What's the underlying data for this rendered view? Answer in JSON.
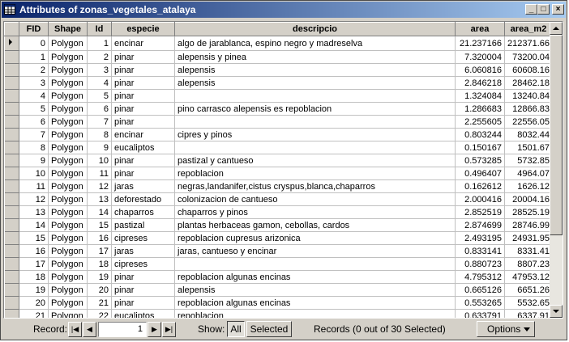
{
  "window": {
    "title": "Attributes of zonas_vegetales_atalaya"
  },
  "title_buttons": {
    "minimize": "_",
    "maximize": "□",
    "close": "×"
  },
  "table": {
    "columns": [
      "FID",
      "Shape",
      "Id",
      "especie",
      "descripcio",
      "area",
      "area_m2"
    ],
    "rows": [
      [
        "0",
        "Polygon",
        "1",
        "encinar",
        "algo de jarablanca, espino negro y madreselva",
        "21.237166",
        "212371.66"
      ],
      [
        "1",
        "Polygon",
        "2",
        "pinar",
        "alepensis y pinea",
        "7.320004",
        "73200.04"
      ],
      [
        "2",
        "Polygon",
        "3",
        "pinar",
        "alepensis",
        "6.060816",
        "60608.16"
      ],
      [
        "3",
        "Polygon",
        "4",
        "pinar",
        "alepensis",
        "2.846218",
        "28462.18"
      ],
      [
        "4",
        "Polygon",
        "5",
        "pinar",
        "",
        "1.324084",
        "13240.84"
      ],
      [
        "5",
        "Polygon",
        "6",
        "pinar",
        "pino carrasco alepensis es repoblacion",
        "1.286683",
        "12866.83"
      ],
      [
        "6",
        "Polygon",
        "7",
        "pinar",
        "",
        "2.255605",
        "22556.05"
      ],
      [
        "7",
        "Polygon",
        "8",
        "encinar",
        "cipres y pinos",
        "0.803244",
        "8032.44"
      ],
      [
        "8",
        "Polygon",
        "9",
        "eucaliptos",
        "",
        "0.150167",
        "1501.67"
      ],
      [
        "9",
        "Polygon",
        "10",
        "pinar",
        "pastizal y cantueso",
        "0.573285",
        "5732.85"
      ],
      [
        "10",
        "Polygon",
        "11",
        "pinar",
        "repoblacion",
        "0.496407",
        "4964.07"
      ],
      [
        "11",
        "Polygon",
        "12",
        "jaras",
        "negras,landanifer,cistus cryspus,blanca,chaparros",
        "0.162612",
        "1626.12"
      ],
      [
        "12",
        "Polygon",
        "13",
        "deforestado",
        "colonizacion de cantueso",
        "2.000416",
        "20004.16"
      ],
      [
        "13",
        "Polygon",
        "14",
        "chaparros",
        "chaparros y pinos",
        "2.852519",
        "28525.19"
      ],
      [
        "14",
        "Polygon",
        "15",
        "pastizal",
        "plantas herbaceas gamon, cebollas, cardos",
        "2.874699",
        "28746.99"
      ],
      [
        "15",
        "Polygon",
        "16",
        "cipreses",
        "repoblacion cupresus arizonica",
        "2.493195",
        "24931.95"
      ],
      [
        "16",
        "Polygon",
        "17",
        "jaras",
        "jaras, cantueso y encinar",
        "0.833141",
        "8331.41"
      ],
      [
        "17",
        "Polygon",
        "18",
        "cipreses",
        "",
        "0.880723",
        "8807.23"
      ],
      [
        "18",
        "Polygon",
        "19",
        "pinar",
        "repoblacion algunas encinas",
        "4.795312",
        "47953.12"
      ],
      [
        "19",
        "Polygon",
        "20",
        "pinar",
        "alepensis",
        "0.665126",
        "6651.26"
      ],
      [
        "20",
        "Polygon",
        "21",
        "pinar",
        "repoblacion algunas encinas",
        "0.553265",
        "5532.65"
      ],
      [
        "21",
        "Polygon",
        "22",
        "eucaliptos",
        "repoblacion",
        "0.633791",
        "6337.91"
      ]
    ]
  },
  "status": {
    "record_label": "Record:",
    "record_value": "1",
    "show_label": "Show:",
    "all_button": "All",
    "selected_button": "Selected",
    "records_text": "Records (0 out of 30 Selected)",
    "options_button": "Options",
    "nav_first": "|◀",
    "nav_prev": "◀",
    "nav_next": "▶",
    "nav_last": "▶|"
  },
  "colors": {
    "title_start": "#0a246a",
    "title_end": "#a6caf0",
    "face": "#d4d0c8"
  }
}
